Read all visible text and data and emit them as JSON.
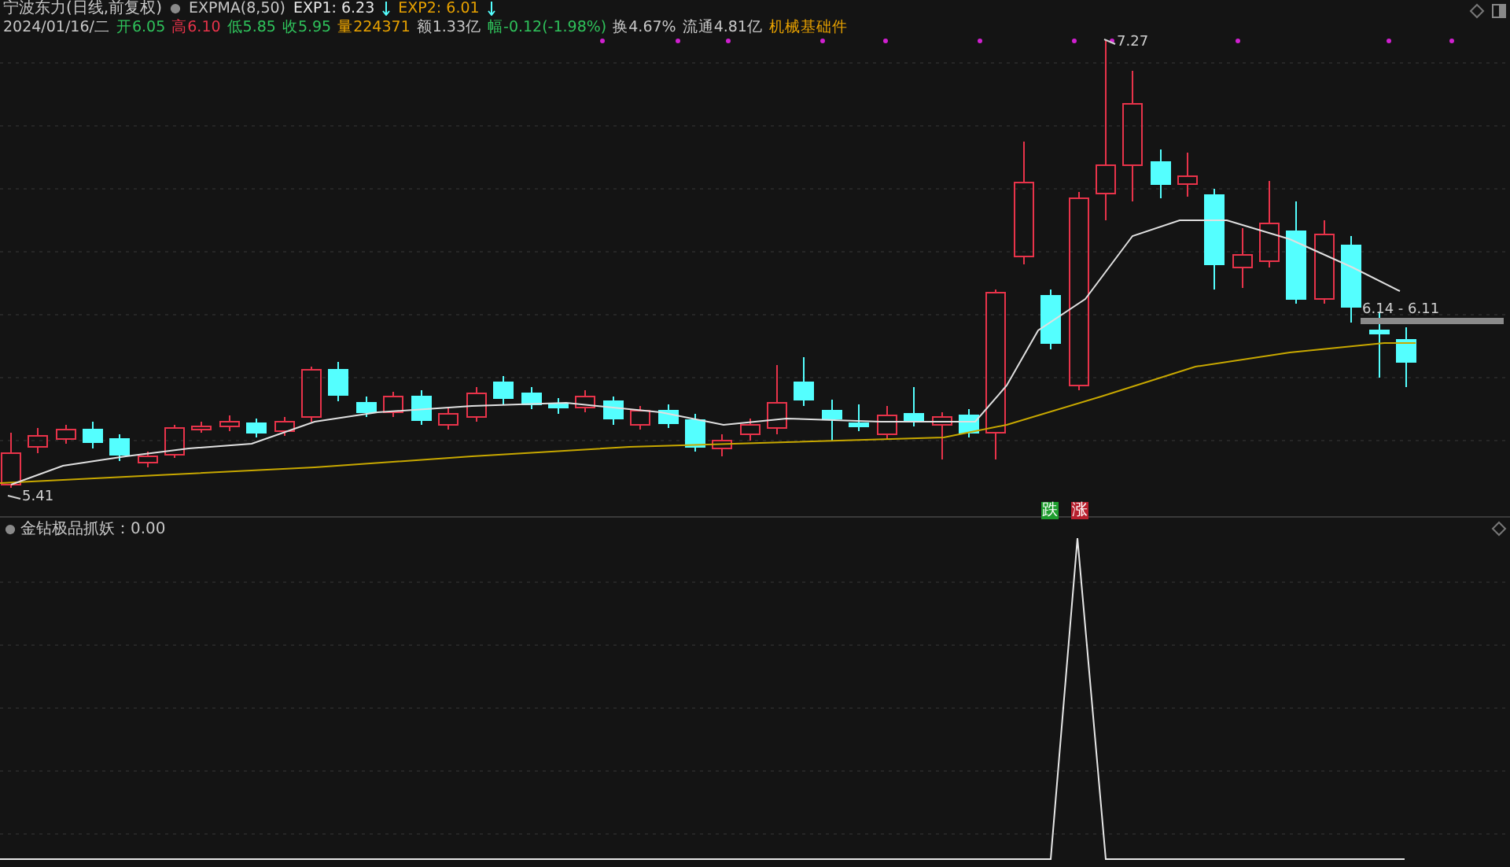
{
  "header": {
    "title": "宁波东力(日线,前复权)",
    "indicator": "EXPMA(8,50)",
    "exp1": "EXP1: 6.23",
    "exp2": "EXP2: 6.01"
  },
  "quote": [
    {
      "text": "2024/01/16/二",
      "color": "#c8c8c8"
    },
    {
      "text": "开6.05",
      "color": "#2fc25b"
    },
    {
      "text": "高6.10",
      "color": "#e8334a"
    },
    {
      "text": "低5.85",
      "color": "#2fc25b"
    },
    {
      "text": "收5.95",
      "color": "#2fc25b"
    },
    {
      "text": "量224371",
      "color": "#e8a200"
    },
    {
      "text": "额1.33亿",
      "color": "#c8c8c8"
    },
    {
      "text": "幅-0.12(-1.98%)",
      "color": "#2fc25b"
    },
    {
      "text": "换4.67%",
      "color": "#c8c8c8"
    },
    {
      "text": "流通4.81亿",
      "color": "#c8c8c8"
    },
    {
      "text": "机械基础件",
      "color": "#e8a200"
    }
  ],
  "chart": {
    "high_label": "7.27",
    "low_label": "5.41",
    "range_label": "6.14 - 6.11"
  },
  "signals": [
    {
      "text": "跌",
      "color": "#1e9e2e"
    },
    {
      "text": "涨",
      "color": "#b8202e"
    }
  ],
  "lower_panel": {
    "label": "金钻极品抓妖：0.00"
  }
}
